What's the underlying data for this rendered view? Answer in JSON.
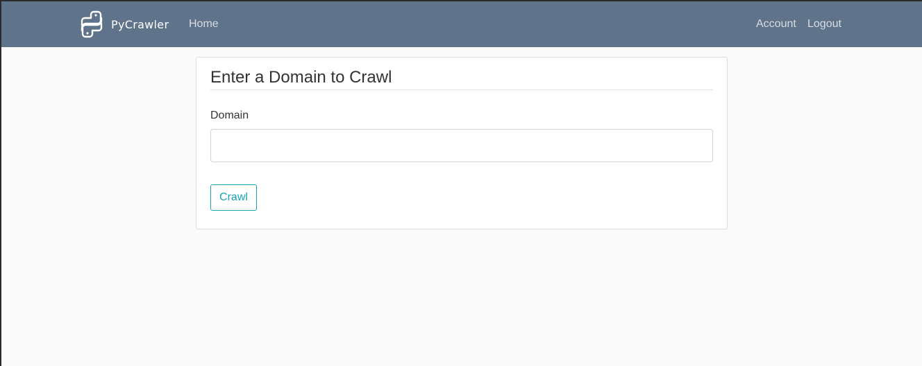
{
  "navbar": {
    "brand": {
      "icon": "python-logo-icon",
      "name": "PyCrawler"
    },
    "links": {
      "home": "Home",
      "account": "Account",
      "logout": "Logout"
    },
    "background_color": "#5f738b"
  },
  "form": {
    "title": "Enter a Domain to Crawl",
    "domain_label": "Domain",
    "domain_value": "",
    "submit_label": "Crawl",
    "accent_color": "#17a2b8"
  }
}
